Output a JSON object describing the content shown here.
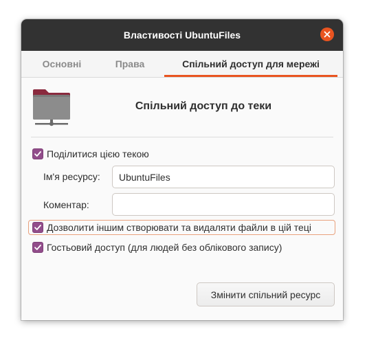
{
  "window": {
    "title": "Властивості UbuntuFiles",
    "close_icon": "close-icon",
    "accent_color": "#e95420"
  },
  "tabs": [
    {
      "label": "Основні",
      "active": false
    },
    {
      "label": "Права",
      "active": false
    },
    {
      "label": "Спільний доступ для мережі",
      "active": true
    }
  ],
  "share": {
    "folder_icon": "shared-folder-icon",
    "heading": "Спільний доступ до теки",
    "share_checkbox": {
      "label": "Поділитися цією текою",
      "checked": true
    },
    "share_name": {
      "label": "Ім'я ресурсу:",
      "value": "UbuntuFiles",
      "placeholder": ""
    },
    "comment": {
      "label": "Коментар:",
      "value": "",
      "placeholder": ""
    },
    "allow_write_checkbox": {
      "label": "Дозволити іншим створювати та видаляти файли в цій теці",
      "checked": true
    },
    "guest_checkbox": {
      "label": "Гостьовий доступ (для людей без облікового запису)",
      "checked": true
    },
    "apply_button": "Змінити спільний ресурс",
    "checkbox_color": "#924d8b"
  }
}
